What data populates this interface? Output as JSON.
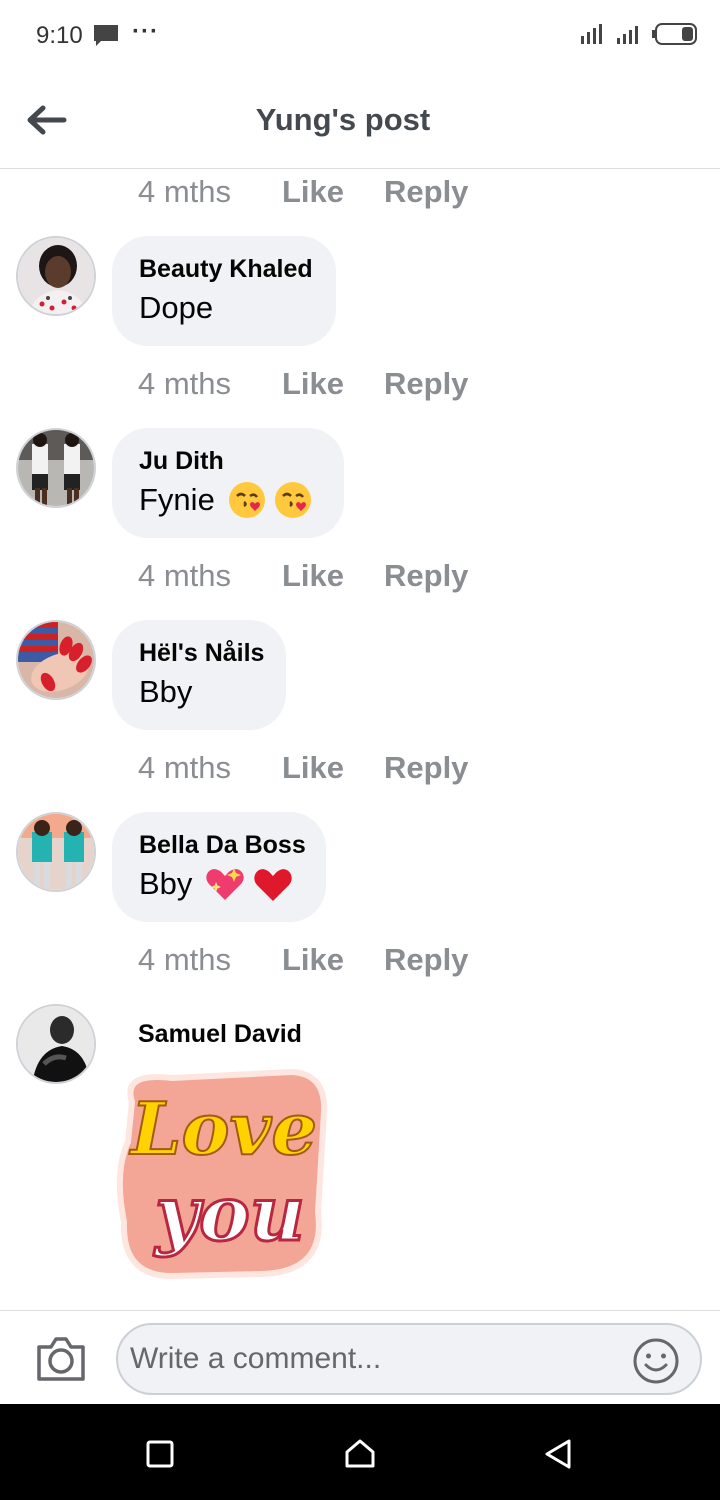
{
  "status_bar": {
    "time": "9:10",
    "dots": "···"
  },
  "header": {
    "title": "Yung's post"
  },
  "comments": [
    {
      "age": "4 mths",
      "like": "Like",
      "reply": "Reply"
    },
    {
      "author": "Beauty Khaled",
      "text": "Dope",
      "age": "4 mths",
      "like": "Like",
      "reply": "Reply"
    },
    {
      "author": "Ju Dith",
      "text": "Fynie",
      "age": "4 mths",
      "like": "Like",
      "reply": "Reply"
    },
    {
      "author": "Hël's Nåils",
      "text": "Bby",
      "age": "4 mths",
      "like": "Like",
      "reply": "Reply"
    },
    {
      "author": "Bella Da Boss",
      "text": "Bby",
      "age": "4 mths",
      "like": "Like",
      "reply": "Reply"
    },
    {
      "author": "Samuel David",
      "sticker_text_line1": "Love",
      "sticker_text_line2": "you"
    }
  ],
  "composer": {
    "placeholder": "Write a comment..."
  },
  "icons": {
    "back": "arrow-left-icon",
    "camera": "camera-icon",
    "emoji": "smiley-icon",
    "nav_recent": "square-icon",
    "nav_home": "home-icon",
    "nav_back": "triangle-back-icon"
  },
  "colors": {
    "bubble": "#f0f2f5",
    "meta_text": "#8a8d91",
    "sticker_bg": "#f0a090",
    "sticker_yellow": "#ffd200"
  }
}
